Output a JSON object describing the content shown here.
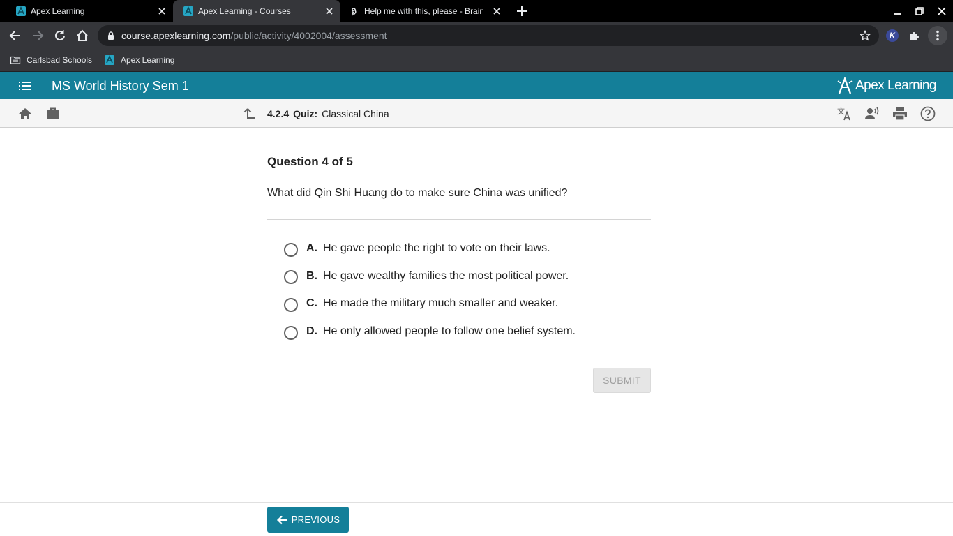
{
  "browser": {
    "tabs": [
      {
        "title": "Apex Learning",
        "active": false
      },
      {
        "title": "Apex Learning - Courses",
        "active": true
      },
      {
        "title": "Help me with this, please - Brainly",
        "active": false
      }
    ],
    "url_host": "course.apexlearning.com",
    "url_path": "/public/activity/4002004/assessment",
    "extension_label": "K",
    "bookmarks": [
      {
        "label": "Carlsbad Schools",
        "icon": "folder-icon"
      },
      {
        "label": "Apex Learning",
        "icon": "apex-favicon"
      }
    ]
  },
  "app": {
    "course_title": "MS World History Sem 1",
    "logo_text": "Apex Learning",
    "brand_color": "#147f99"
  },
  "activity": {
    "number": "4.2.4",
    "type": "Quiz:",
    "title": "Classical China"
  },
  "question": {
    "heading": "Question 4 of 5",
    "text": "What did Qin Shi Huang do to make sure China was unified?",
    "options": [
      {
        "letter": "A.",
        "text": "He gave people the right to vote on their laws."
      },
      {
        "letter": "B.",
        "text": "He gave wealthy families the most political power."
      },
      {
        "letter": "C.",
        "text": "He made the military much smaller and weaker."
      },
      {
        "letter": "D.",
        "text": "He only allowed people to follow one belief system."
      }
    ]
  },
  "actions": {
    "submit_label": "SUBMIT",
    "previous_label": "PREVIOUS"
  }
}
